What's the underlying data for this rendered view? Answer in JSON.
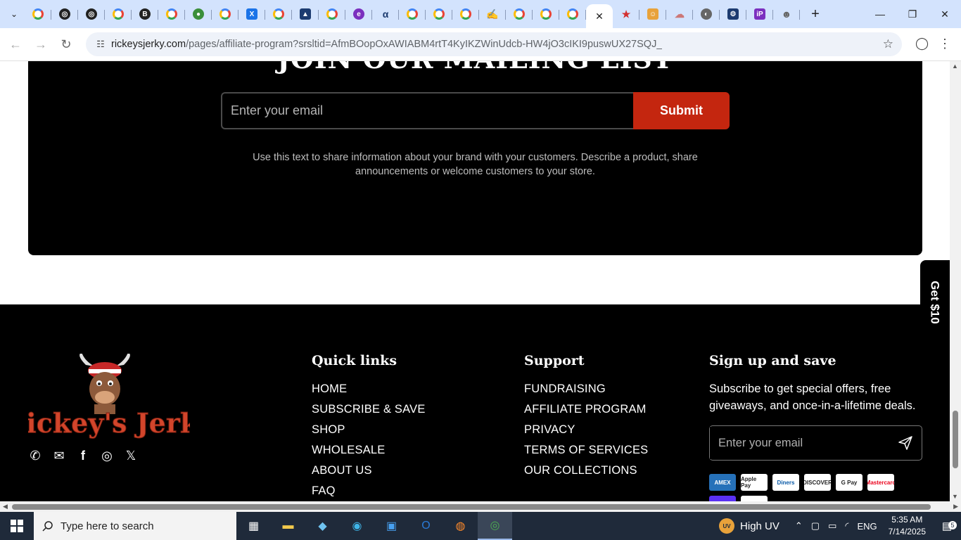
{
  "browser": {
    "tabs": [
      {
        "icon": "google-icon"
      },
      {
        "icon": "openai-icon"
      },
      {
        "icon": "openai-icon"
      },
      {
        "icon": "google-icon"
      },
      {
        "icon": "b-icon"
      },
      {
        "icon": "google-icon"
      },
      {
        "icon": "green-globe-icon"
      },
      {
        "icon": "google-icon"
      },
      {
        "icon": "excel-icon"
      },
      {
        "icon": "google-icon"
      },
      {
        "icon": "graduation-cap-icon"
      },
      {
        "icon": "google-icon"
      },
      {
        "icon": "copilot-icon"
      },
      {
        "icon": "alpha-icon"
      },
      {
        "icon": "google-icon"
      },
      {
        "icon": "google-icon"
      },
      {
        "icon": "google-icon"
      },
      {
        "icon": "signature-icon"
      },
      {
        "icon": "google-icon"
      },
      {
        "icon": "google-icon"
      },
      {
        "icon": "google-icon"
      },
      {
        "icon": "close-icon",
        "active": true
      },
      {
        "icon": "star-icon"
      },
      {
        "icon": "orange-app-icon"
      },
      {
        "icon": "cloud-icon"
      },
      {
        "icon": "globe-icon"
      },
      {
        "icon": "gear-icon"
      },
      {
        "icon": "ip-icon"
      },
      {
        "icon": "face-icon"
      }
    ],
    "url_host": "rickeysjerky.com",
    "url_path": "/pages/affiliate-program?srsltid=AfmBOopOxAWIABM4rtT4KyIKZWinUdcb-HW4jO3cIKI9puswUX27SQJ_"
  },
  "newsletter": {
    "heading": "JOIN OUR MAILING LIST",
    "email_placeholder": "Enter your email",
    "submit_label": "Submit",
    "description": "Use this text to share information about your brand with your customers. Describe a product, share announcements or welcome customers to your store."
  },
  "footer": {
    "quick_links": {
      "title": "Quick links",
      "items": [
        "HOME",
        "SUBSCRIBE & SAVE",
        "SHOP",
        "WHOLESALE",
        "ABOUT US",
        "FAQ"
      ]
    },
    "support": {
      "title": "Support",
      "items": [
        "FUNDRAISING",
        "AFFILIATE PROGRAM",
        "PRIVACY",
        "TERMS OF SERVICES",
        "OUR COLLECTIONS"
      ]
    },
    "signup": {
      "title": "Sign up and save",
      "text": "Subscribe to get special offers, free giveaways, and once-in-a-lifetime deals.",
      "email_placeholder": "Enter your email"
    },
    "logo_text": "Rickey's Jerky",
    "payments": [
      "AMEX",
      "Apple Pay",
      "Diners",
      "DISCOVER",
      "G Pay",
      "Mastercard",
      "Shop Pay",
      "VISA"
    ]
  },
  "floating_tab": "Get $10",
  "taskbar": {
    "search_placeholder": "Type here to search",
    "uv_badge": "UV",
    "uv_label": "High UV",
    "language": "ENG",
    "time": "5:35 AM",
    "date": "7/14/2025",
    "notification_count": "5"
  }
}
